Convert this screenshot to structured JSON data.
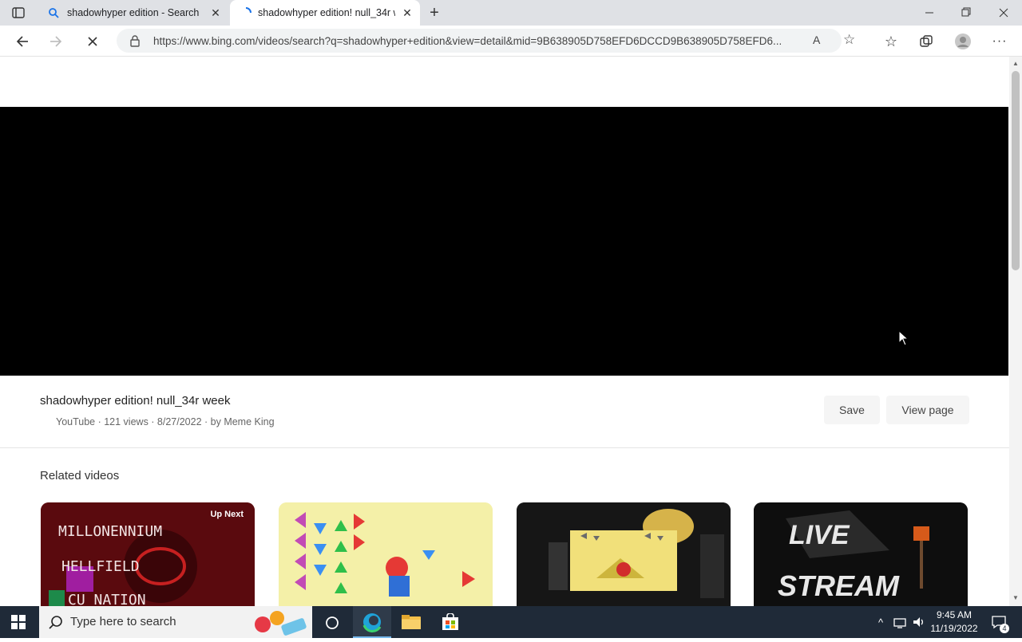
{
  "browser": {
    "tabs": [
      {
        "title": "shadowhyper edition - Search",
        "active": false
      },
      {
        "title": "shadowhyper edition! null_34r w",
        "active": true
      }
    ],
    "url": "https://www.bing.com/videos/search?q=shadowhyper+edition&view=detail&mid=9B638905D758EFD6DCCD9B638905D758EFD6..."
  },
  "video": {
    "title": "shadowhyper edition! null_34r week",
    "meta": "YouTube · 121 views · 8/27/2022 · by Meme King",
    "save_label": "Save",
    "view_page_label": "View page"
  },
  "related": {
    "heading": "Related videos",
    "cards": [
      {
        "badge": "Up Next",
        "text_lines": [
          "MILLONENNIUM",
          "HELLFIELD",
          "CU  NATION"
        ]
      },
      {
        "badge": ""
      },
      {
        "badge": ""
      },
      {
        "badge": "",
        "text_lines": [
          "LIVE",
          "STREAM"
        ]
      }
    ]
  },
  "taskbar": {
    "search_placeholder": "Type here to search",
    "time": "9:45 AM",
    "date": "11/19/2022",
    "notification_count": "4"
  },
  "colors": {
    "tabstrip": "#dfe1e5",
    "taskbar": "#1f2a38",
    "player": "#000000",
    "accent": "#0078d4"
  }
}
